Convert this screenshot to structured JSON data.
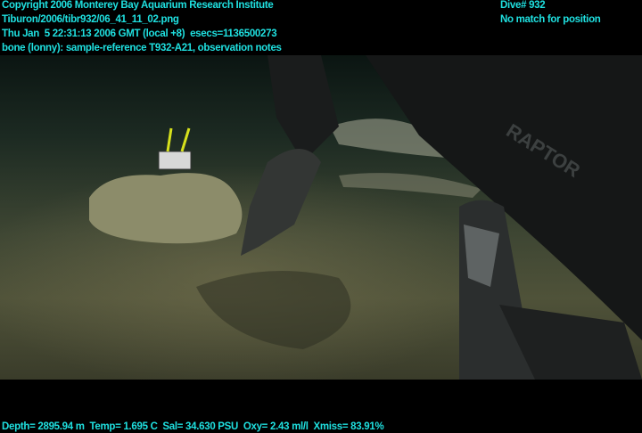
{
  "overlay": {
    "top_left": [
      "Copyright 2006 Monterey Bay Aquarium Research Institute",
      "Tiburon/2006/tibr932/06_41_11_02.png",
      "Thu Jan  5 22:31:13 2006 GMT (local +8)  esecs=1136500273",
      "bone (lonny): sample-reference T932-A21, observation notes"
    ],
    "top_right": [
      "Dive# 932",
      "No match for position"
    ],
    "bottom": "Depth= 2895.94 m  Temp= 1.695 C  Sal= 34.630 PSU  Oxy= 2.43 ml/l  Xmiss= 83.91%"
  },
  "scene": {
    "arm_label": "RAPTOR"
  },
  "colors": {
    "overlay_text": "#1fe0e0"
  }
}
